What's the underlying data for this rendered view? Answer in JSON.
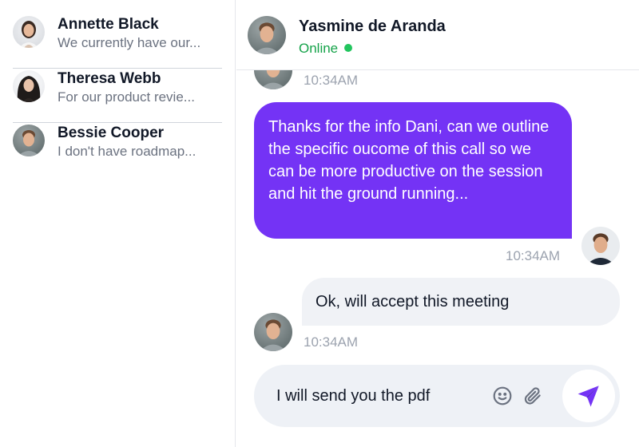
{
  "conversations": [
    {
      "name": "Annette Black",
      "preview": "We currently have our..."
    },
    {
      "name": "Theresa Webb",
      "preview": "For our product revie..."
    },
    {
      "name": "Bessie Cooper",
      "preview": "I don't have roadmap..."
    }
  ],
  "chat": {
    "contact_name": "Yasmine de Aranda",
    "status": "Online"
  },
  "messages": [
    {
      "type": "received",
      "time": "10:34AM"
    },
    {
      "type": "sent",
      "text": "Thanks for the info Dani, can we outline the specific oucome of this call so we can be more productive on the session and hit the ground running...",
      "time": "10:34AM"
    },
    {
      "type": "received",
      "text": "Ok, will accept this meeting",
      "time": "10:34AM"
    }
  ],
  "composer": {
    "value": "I will send you the pdf"
  },
  "colors": {
    "accent": "#7433f5",
    "online": "#22c55e",
    "bubble_received": "#f0f2f6",
    "composer_bg": "#eef1f6"
  },
  "icons": [
    "emoji-icon",
    "paperclip-icon",
    "send-icon"
  ]
}
